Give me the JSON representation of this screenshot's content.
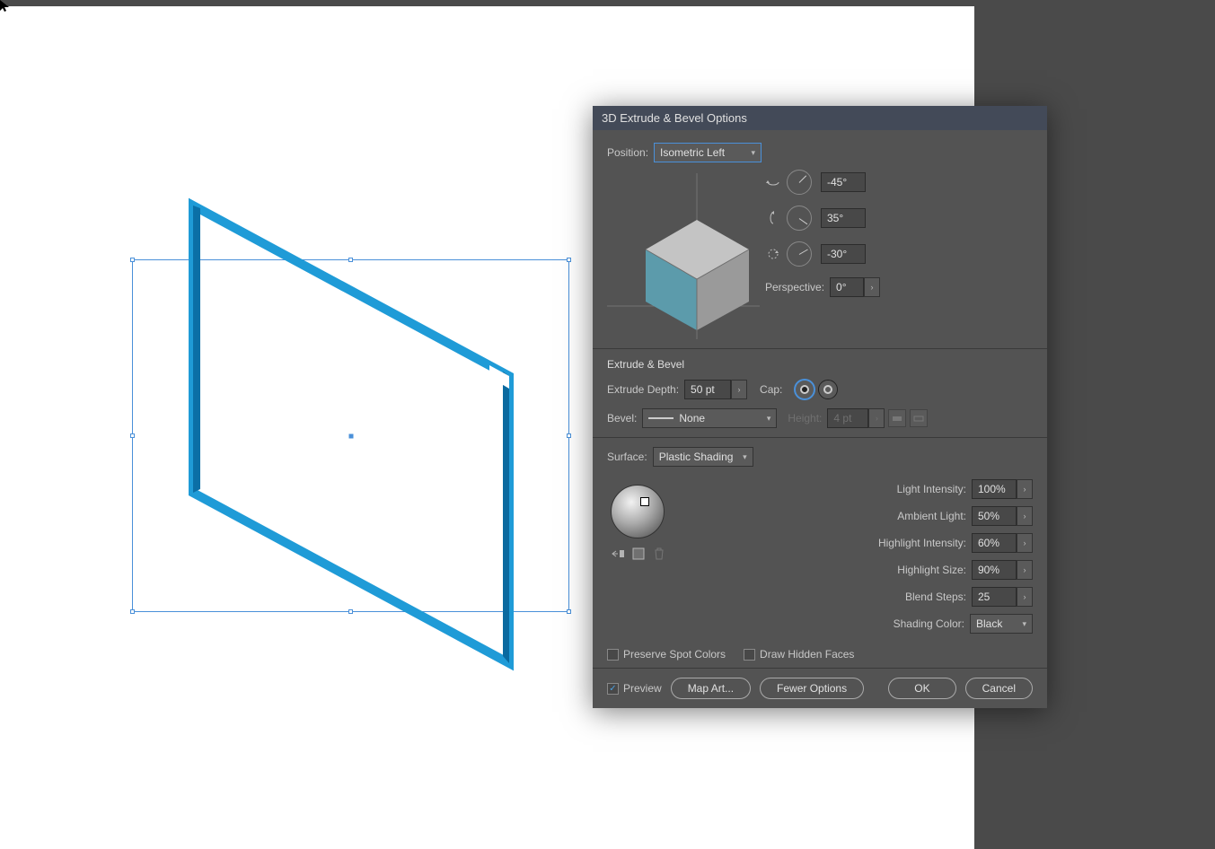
{
  "dialog": {
    "title": "3D Extrude & Bevel Options",
    "position_label": "Position:",
    "position_value": "Isometric Left",
    "rotation": {
      "x": "-45°",
      "y": "35°",
      "z": "-30°"
    },
    "perspective_label": "Perspective:",
    "perspective_value": "0°",
    "extrude": {
      "header": "Extrude & Bevel",
      "depth_label": "Extrude Depth:",
      "depth_value": "50 pt",
      "cap_label": "Cap:",
      "bevel_label": "Bevel:",
      "bevel_value": "None",
      "height_label": "Height:",
      "height_value": "4 pt"
    },
    "surface": {
      "label": "Surface:",
      "value": "Plastic Shading",
      "light_intensity_label": "Light Intensity:",
      "light_intensity": "100%",
      "ambient_label": "Ambient Light:",
      "ambient": "50%",
      "highlight_intensity_label": "Highlight Intensity:",
      "highlight_intensity": "60%",
      "highlight_size_label": "Highlight Size:",
      "highlight_size": "90%",
      "blend_steps_label": "Blend Steps:",
      "blend_steps": "25",
      "shading_color_label": "Shading Color:",
      "shading_color": "Black"
    },
    "preserve_spot_label": "Preserve Spot Colors",
    "draw_hidden_label": "Draw Hidden Faces",
    "preview_label": "Preview",
    "map_art_label": "Map Art...",
    "fewer_opts_label": "Fewer Options",
    "ok_label": "OK",
    "cancel_label": "Cancel"
  }
}
